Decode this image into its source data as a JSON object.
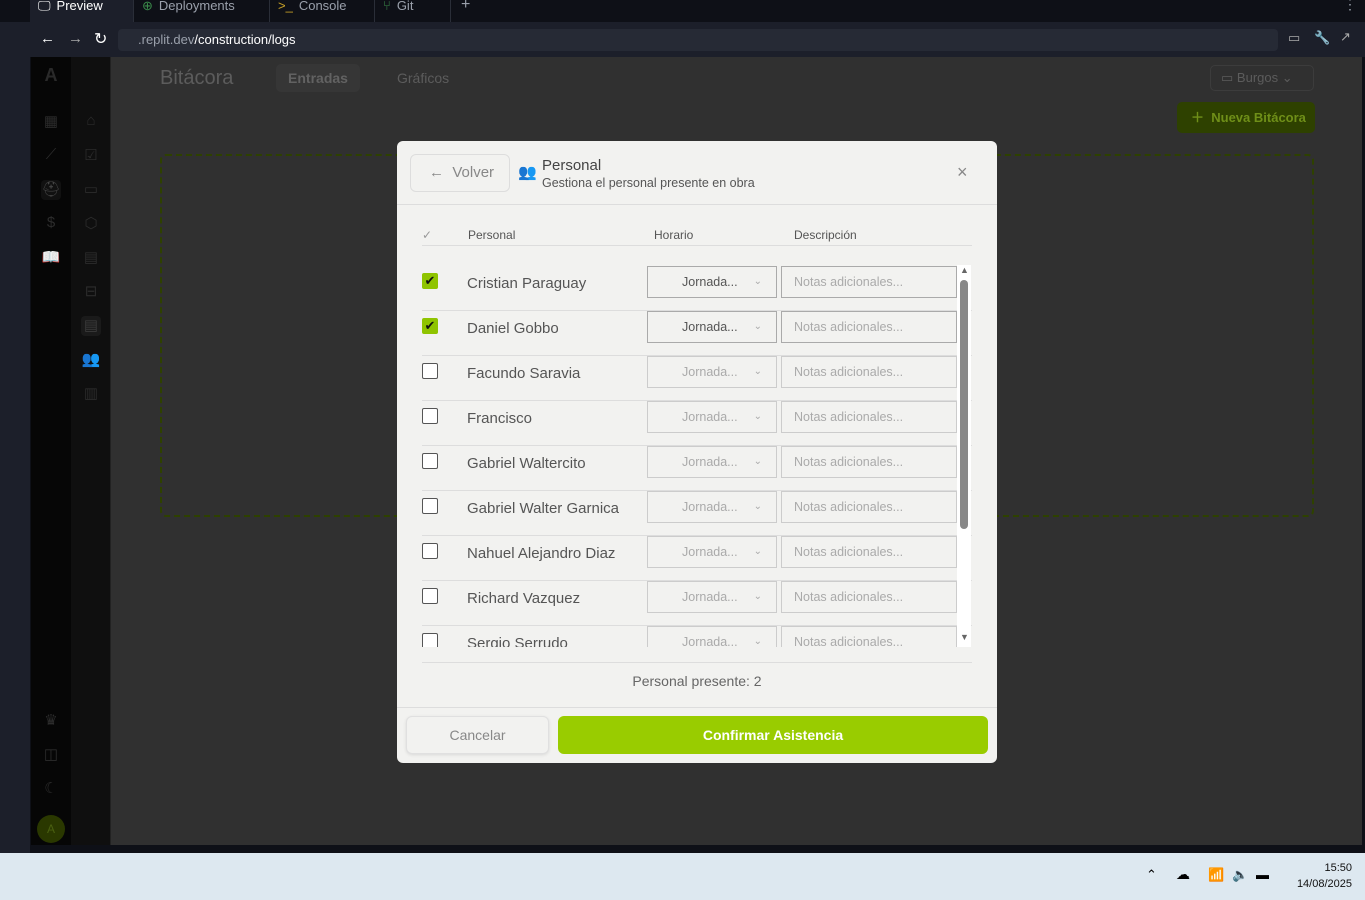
{
  "browser": {
    "tabs": [
      {
        "label": "Preview",
        "icon": "monitor-icon"
      },
      {
        "label": "Deployments",
        "icon": "globe-icon"
      },
      {
        "label": "Console",
        "icon": "terminal-icon"
      },
      {
        "label": "Git",
        "icon": "git-icon"
      }
    ],
    "url_host": ".replit.dev",
    "url_path": "/construction/logs"
  },
  "app": {
    "logo": "A",
    "title": "Bitácora",
    "tabs": [
      "Entradas",
      "Gráficos"
    ],
    "project": "Burgos",
    "new_button": "Nueva Bitácora",
    "avatar": "A"
  },
  "modal": {
    "back": "Volver",
    "title": "Personal",
    "subtitle": "Gestiona el personal presente en obra",
    "headers": {
      "check": "✓",
      "name": "Personal",
      "schedule": "Horario",
      "description": "Descripción"
    },
    "rows": [
      {
        "name": "Cristian Paraguay",
        "checked": true,
        "schedule": "Jornada...",
        "notes_placeholder": "Notas adicionales..."
      },
      {
        "name": "Daniel Gobbo",
        "checked": true,
        "schedule": "Jornada...",
        "notes_placeholder": "Notas adicionales..."
      },
      {
        "name": "Facundo Saravia",
        "checked": false,
        "schedule": "Jornada...",
        "notes_placeholder": "Notas adicionales..."
      },
      {
        "name": "Francisco",
        "checked": false,
        "schedule": "Jornada...",
        "notes_placeholder": "Notas adicionales..."
      },
      {
        "name": "Gabriel Waltercito",
        "checked": false,
        "schedule": "Jornada...",
        "notes_placeholder": "Notas adicionales..."
      },
      {
        "name": "Gabriel Walter Garnica",
        "checked": false,
        "schedule": "Jornada...",
        "notes_placeholder": "Notas adicionales..."
      },
      {
        "name": "Nahuel Alejandro Diaz",
        "checked": false,
        "schedule": "Jornada...",
        "notes_placeholder": "Notas adicionales..."
      },
      {
        "name": "Richard Vazquez",
        "checked": false,
        "schedule": "Jornada...",
        "notes_placeholder": "Notas adicionales..."
      },
      {
        "name": "Sergio Serrudo",
        "checked": false,
        "schedule": "Jornada...",
        "notes_placeholder": "Notas adicionales..."
      }
    ],
    "present_count": "Personal presente: 2",
    "cancel": "Cancelar",
    "confirm": "Confirmar Asistencia",
    "accent": "#99cc00"
  },
  "taskbar": {
    "time": "15:50",
    "date": "14/08/2025"
  }
}
